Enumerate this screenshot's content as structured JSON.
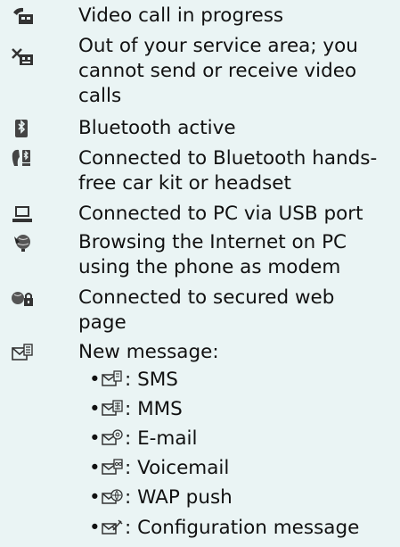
{
  "items": [
    {
      "icon": "video-call-icon",
      "lines": [
        "Video call in progress"
      ]
    },
    {
      "icon": "no-service-video-icon",
      "lines": [
        "Out of your service area; you",
        "cannot send or receive video",
        "calls"
      ]
    },
    {
      "icon": "bluetooth-icon",
      "lines": [
        "Bluetooth active"
      ]
    },
    {
      "icon": "bluetooth-handsfree-icon",
      "lines": [
        "Connected to Bluetooth hands-",
        "free car kit or headset"
      ]
    },
    {
      "icon": "pc-usb-icon",
      "lines": [
        "Connected to PC via USB port"
      ]
    },
    {
      "icon": "browsing-modem-icon",
      "lines": [
        "Browsing the Internet on PC",
        "using the phone as modem"
      ]
    },
    {
      "icon": "secured-web-icon",
      "lines": [
        "Connected to secured web",
        "page"
      ]
    },
    {
      "icon": "new-message-icon",
      "lines": [
        "New message:"
      ]
    }
  ],
  "message_types": [
    {
      "icon": "sms-icon",
      "label": ": SMS"
    },
    {
      "icon": "mms-icon",
      "label": ": MMS"
    },
    {
      "icon": "email-icon",
      "label": ": E-mail"
    },
    {
      "icon": "voicemail-icon",
      "label": ": Voicemail"
    },
    {
      "icon": "wap-push-icon",
      "label": ": WAP push"
    },
    {
      "icon": "configuration-message-icon",
      "label": ": Configuration message"
    }
  ],
  "bullet": "•"
}
